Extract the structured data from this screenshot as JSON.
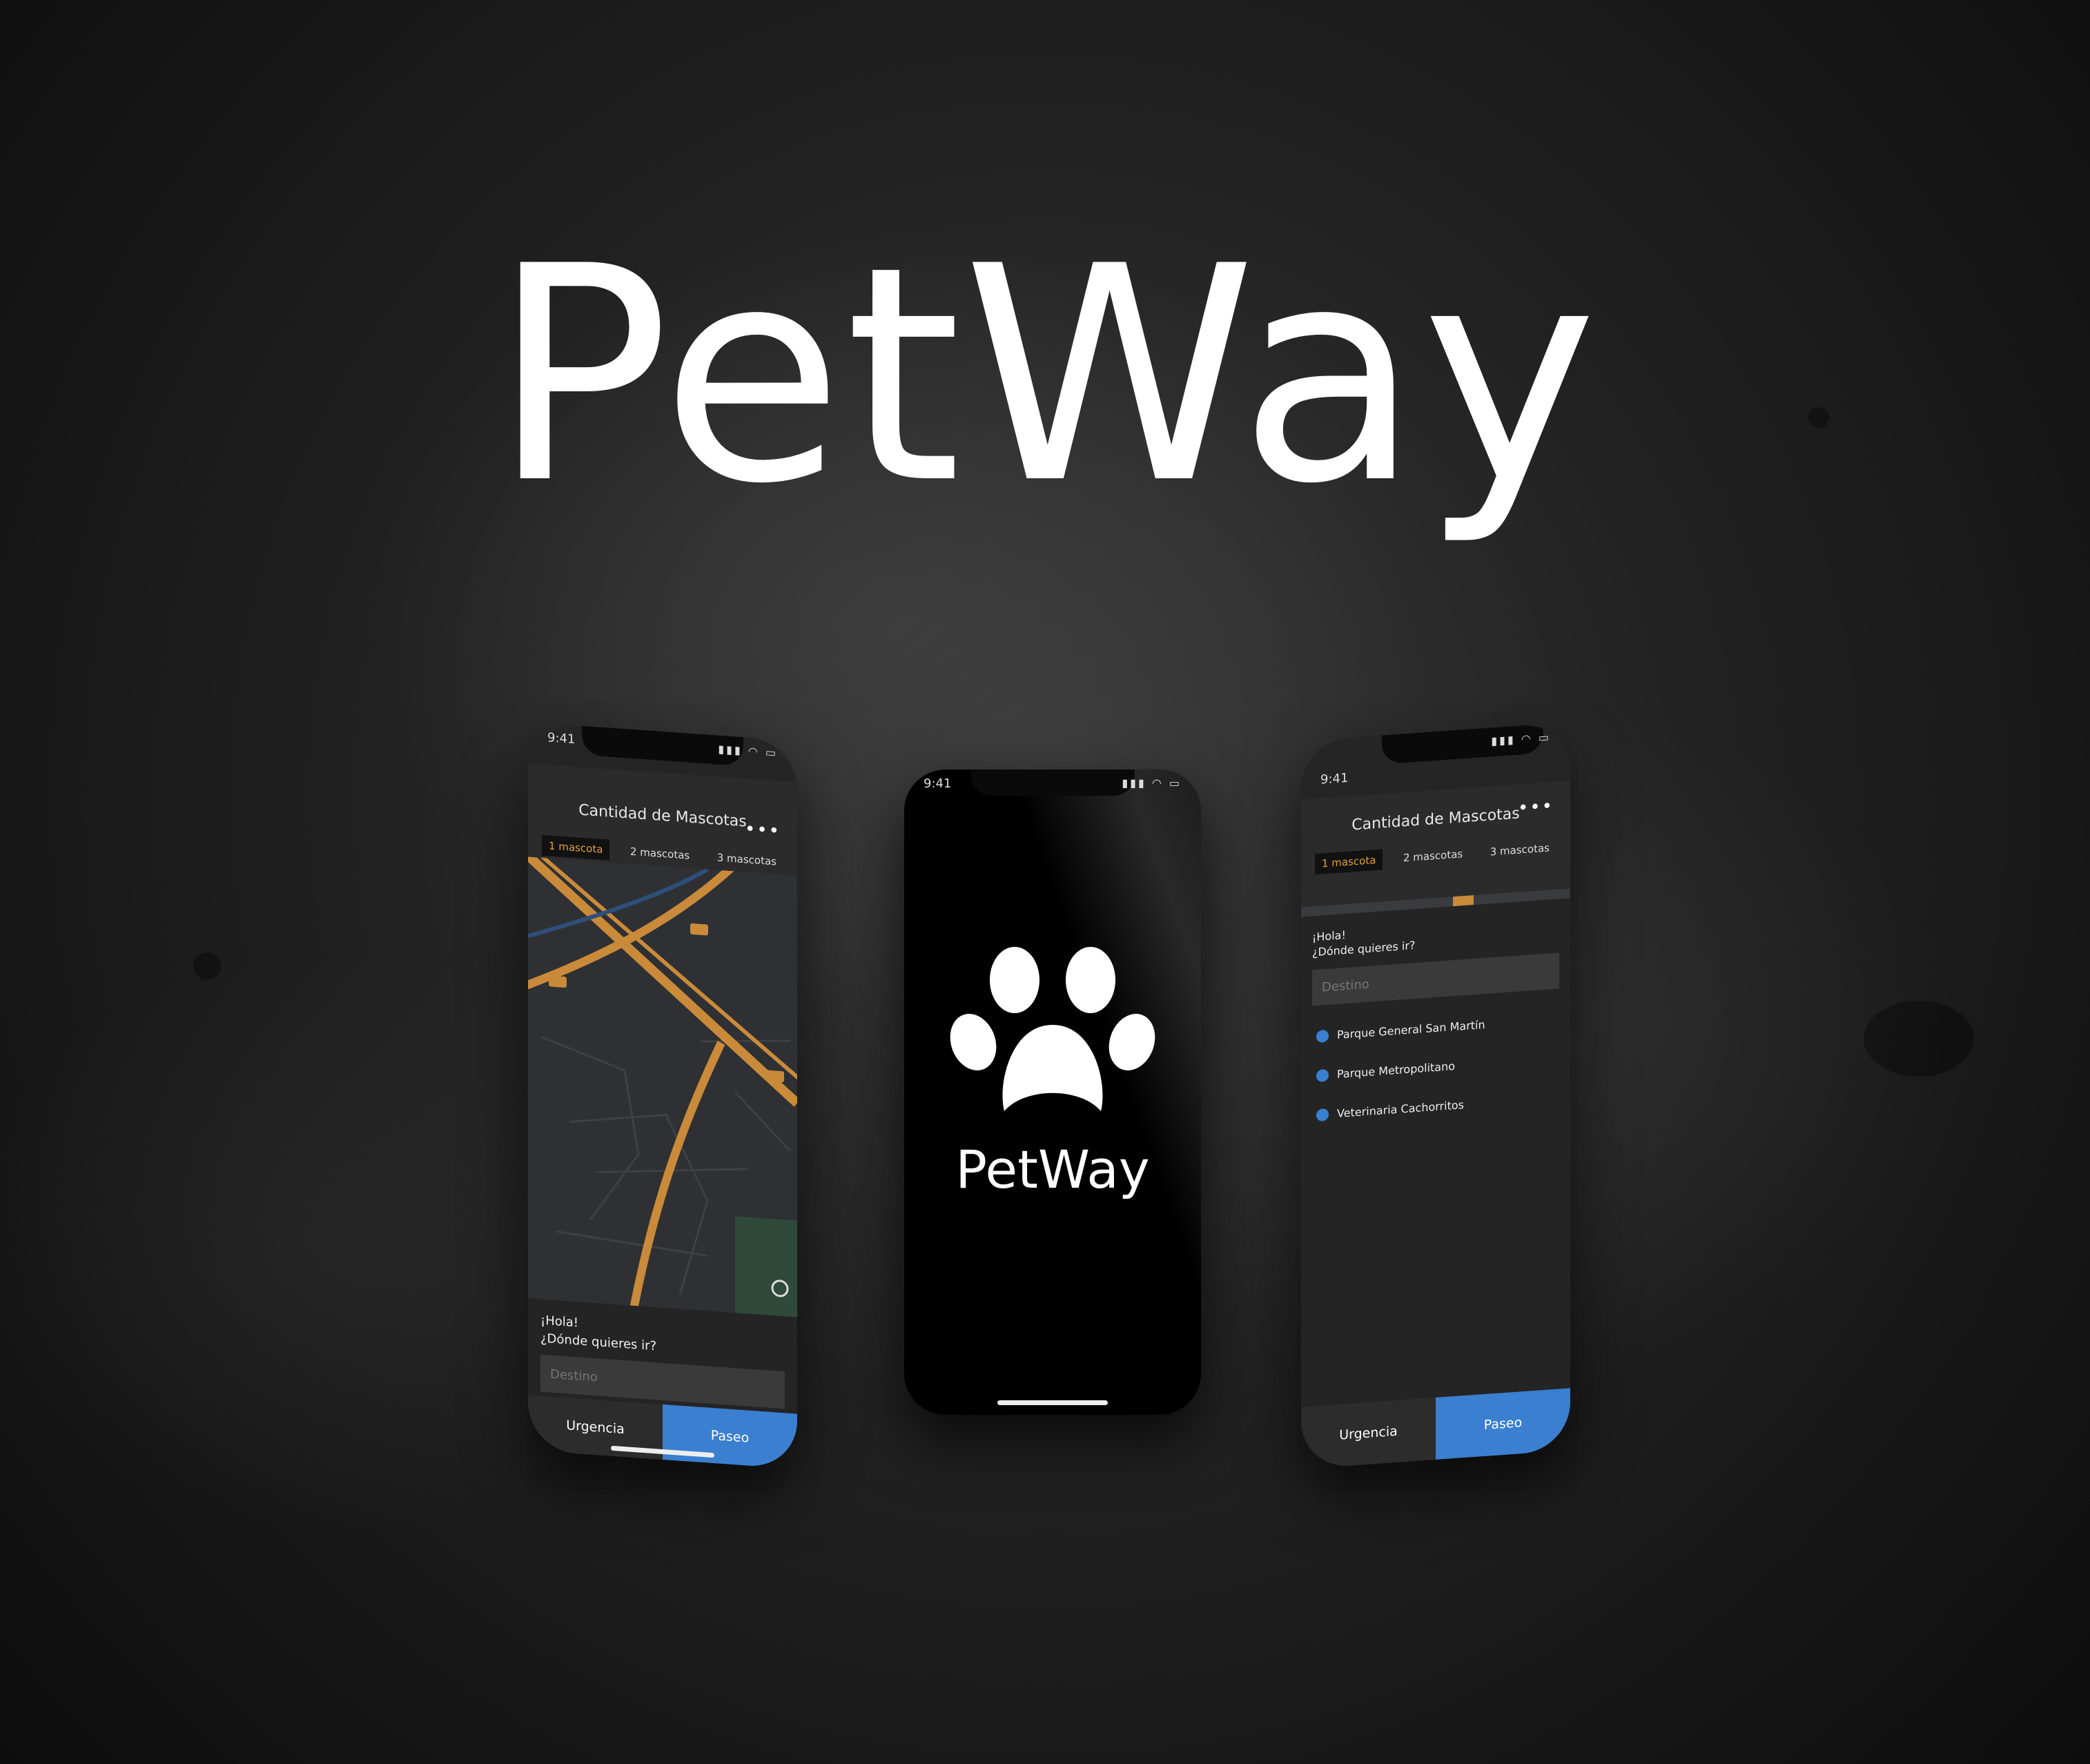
{
  "brand": {
    "title": "PetWay"
  },
  "status_bar": {
    "time": "9:41",
    "icons": "▮▮▮ ◠ ▭"
  },
  "app": {
    "header_title": "Cantidad de Mascotas",
    "more_icon": "•••",
    "tabs": [
      "1 mascota",
      "2 mascotas",
      "3 mascotas"
    ],
    "greeting_line1": "¡Hola!",
    "greeting_line2": "¿Dónde quieres ir?",
    "destination_placeholder": "Destino",
    "buttons": {
      "urgencia": "Urgencia",
      "paseo": "Paseo"
    },
    "suggestions": [
      "Parque General San Martín",
      "Parque Metropolitano",
      "Veterinaria Cachorritos"
    ]
  },
  "splash": {
    "name": "PetWay"
  },
  "colors": {
    "accent_blue": "#3a7fd0",
    "tab_active": "#e0a23a",
    "map_road": "#c98a3a"
  }
}
